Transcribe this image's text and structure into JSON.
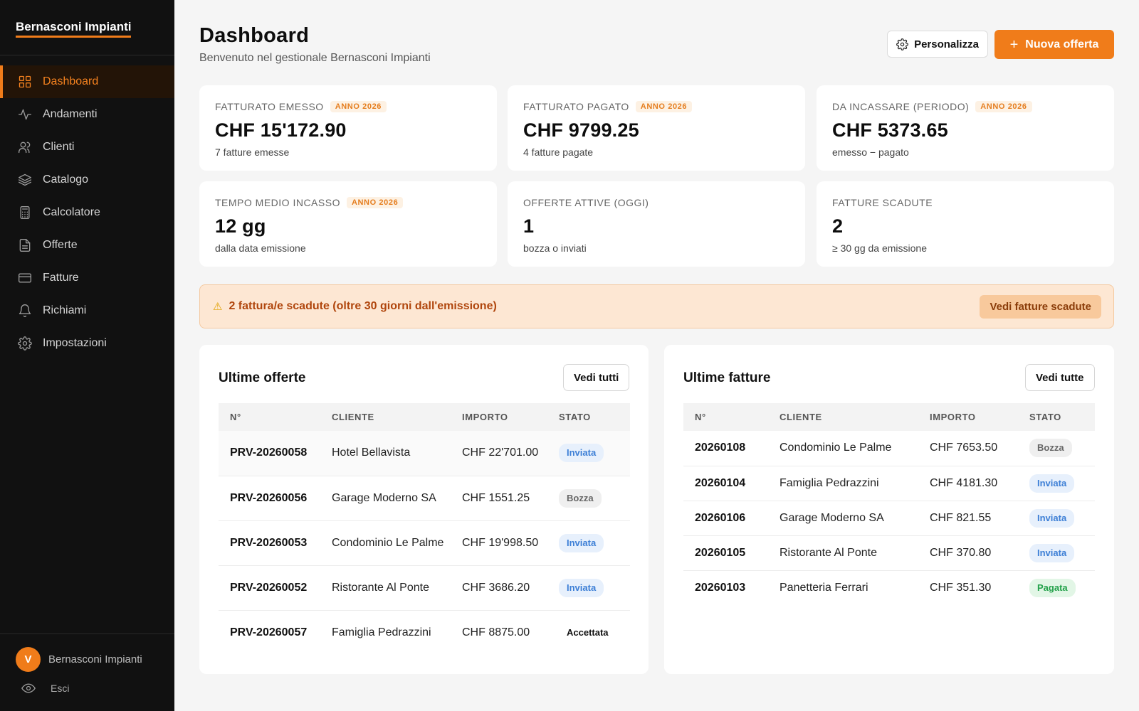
{
  "app": {
    "brand": "Bernasconi Impianti"
  },
  "sidebar": {
    "items": [
      {
        "label": "Dashboard",
        "icon": "grid-icon",
        "active": true
      },
      {
        "label": "Andamenti",
        "icon": "activity-icon"
      },
      {
        "label": "Clienti",
        "icon": "users-icon"
      },
      {
        "label": "Catalogo",
        "icon": "layers-icon"
      },
      {
        "label": "Calcolatore",
        "icon": "calculator-icon"
      },
      {
        "label": "Offerte",
        "icon": "file-icon"
      },
      {
        "label": "Fatture",
        "icon": "credit-card-icon"
      },
      {
        "label": "Richiami",
        "icon": "bell-icon"
      },
      {
        "label": "Impostazioni",
        "icon": "gear-icon"
      }
    ],
    "user": {
      "initial": "V",
      "name": "Bernasconi Impianti"
    },
    "logout_label": "Esci"
  },
  "header": {
    "title": "Dashboard",
    "subtitle": "Benvenuto nel gestionale Bernasconi Impianti",
    "customize_label": "Personalizza",
    "new_offer_label": "Nuova offerta"
  },
  "kpis": [
    {
      "label": "FATTURATO EMESSO",
      "badge": "ANNO 2026",
      "value": "CHF 15'172.90",
      "sub": "7 fatture emesse"
    },
    {
      "label": "FATTURATO PAGATO",
      "badge": "ANNO 2026",
      "value": "CHF 9799.25",
      "sub": "4 fatture pagate"
    },
    {
      "label": "DA INCASSARE (PERIODO)",
      "badge": "ANNO 2026",
      "value": "CHF 5373.65",
      "sub": "emesso − pagato"
    },
    {
      "label": "TEMPO MEDIO INCASSO",
      "badge": "ANNO 2026",
      "value": "12 gg",
      "sub": "dalla data emissione"
    },
    {
      "label": "OFFERTE ATTIVE (OGGI)",
      "badge": "",
      "value": "1",
      "sub": "bozza o inviati"
    },
    {
      "label": "FATTURE SCADUTE",
      "badge": "",
      "value": "2",
      "sub": "≥ 30 gg da emissione"
    }
  ],
  "alert": {
    "icon": "⚠",
    "text": "2 fattura/e scadute (oltre 30 giorni dall'emissione)",
    "button_label": "Vedi fatture scadute"
  },
  "offers": {
    "title": "Ultime offerte",
    "button_label": "Vedi tutti",
    "columns": [
      "N°",
      "CLIENTE",
      "IMPORTO",
      "STATO"
    ],
    "rows": [
      {
        "num": "PRV-20260058",
        "client": "Hotel Bellavista",
        "amount": "CHF 22'701.00",
        "status": "Inviata"
      },
      {
        "num": "PRV-20260056",
        "client": "Garage Moderno SA",
        "amount": "CHF 1551.25",
        "status": "Bozza"
      },
      {
        "num": "PRV-20260053",
        "client": "Condominio Le Palme",
        "amount": "CHF 19'998.50",
        "status": "Inviata"
      },
      {
        "num": "PRV-20260052",
        "client": "Ristorante Al Ponte",
        "amount": "CHF 3686.20",
        "status": "Inviata"
      },
      {
        "num": "PRV-20260057",
        "client": "Famiglia Pedrazzini",
        "amount": "CHF 8875.00",
        "status": "Accettata"
      }
    ]
  },
  "invoices": {
    "title": "Ultime fatture",
    "button_label": "Vedi tutte",
    "columns": [
      "N°",
      "CLIENTE",
      "IMPORTO",
      "STATO"
    ],
    "rows": [
      {
        "num": "20260108",
        "client": "Condominio Le Palme",
        "amount": "CHF 7653.50",
        "status": "Bozza"
      },
      {
        "num": "20260104",
        "client": "Famiglia Pedrazzini",
        "amount": "CHF 4181.30",
        "status": "Inviata"
      },
      {
        "num": "20260106",
        "client": "Garage Moderno SA",
        "amount": "CHF 821.55",
        "status": "Inviata"
      },
      {
        "num": "20260105",
        "client": "Ristorante Al Ponte",
        "amount": "CHF 370.80",
        "status": "Inviata"
      },
      {
        "num": "20260103",
        "client": "Panetteria Ferrari",
        "amount": "CHF 351.30",
        "status": "Pagata"
      }
    ]
  },
  "colors": {
    "accent": "#f07c1a",
    "sidebar_bg": "#111111",
    "page_bg": "#f5f5f5"
  }
}
